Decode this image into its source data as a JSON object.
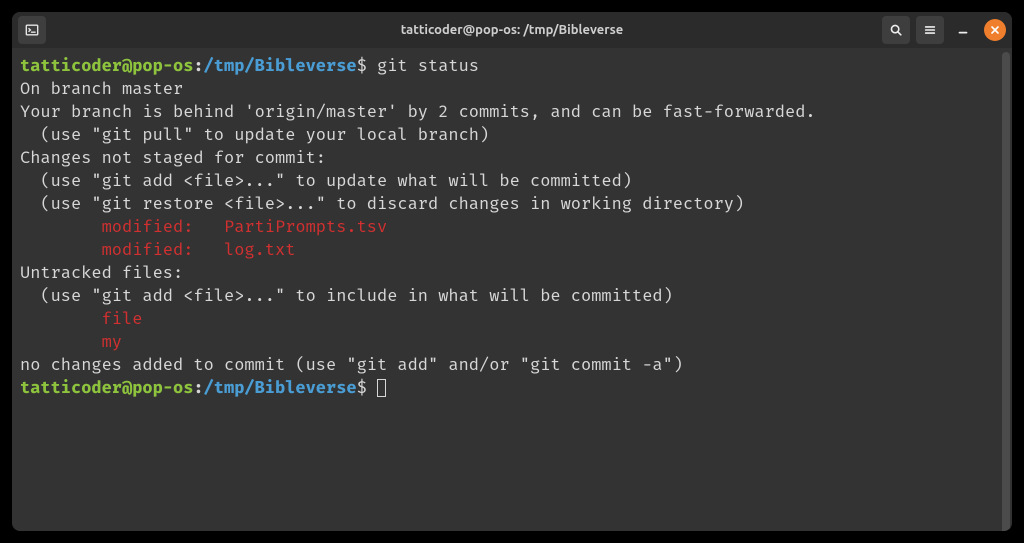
{
  "titlebar": {
    "title": "tatticoder@pop-os: /tmp/Bibleverse"
  },
  "prompt": {
    "user": "tatticoder",
    "at": "@",
    "host": "pop-os",
    "colon": ":",
    "path": "/tmp/Bibleverse",
    "dollar": "$"
  },
  "cmd1": "git status",
  "out": {
    "l1": "On branch master",
    "l2": "Your branch is behind 'origin/master' by 2 commits, and can be fast-forwarded.",
    "l3": "  (use \"git pull\" to update your local branch)",
    "l4": "",
    "l5": "Changes not staged for commit:",
    "l6": "  (use \"git add <file>...\" to update what will be committed)",
    "l7": "  (use \"git restore <file>...\" to discard changes in working directory)",
    "l8": "        modified:   PartiPrompts.tsv",
    "l9": "        modified:   log.txt",
    "l10": "",
    "l11": "Untracked files:",
    "l12": "  (use \"git add <file>...\" to include in what will be committed)",
    "l13": "        file",
    "l14": "        my",
    "l15": "",
    "l16": "no changes added to commit (use \"git add\" and/or \"git commit -a\")"
  }
}
